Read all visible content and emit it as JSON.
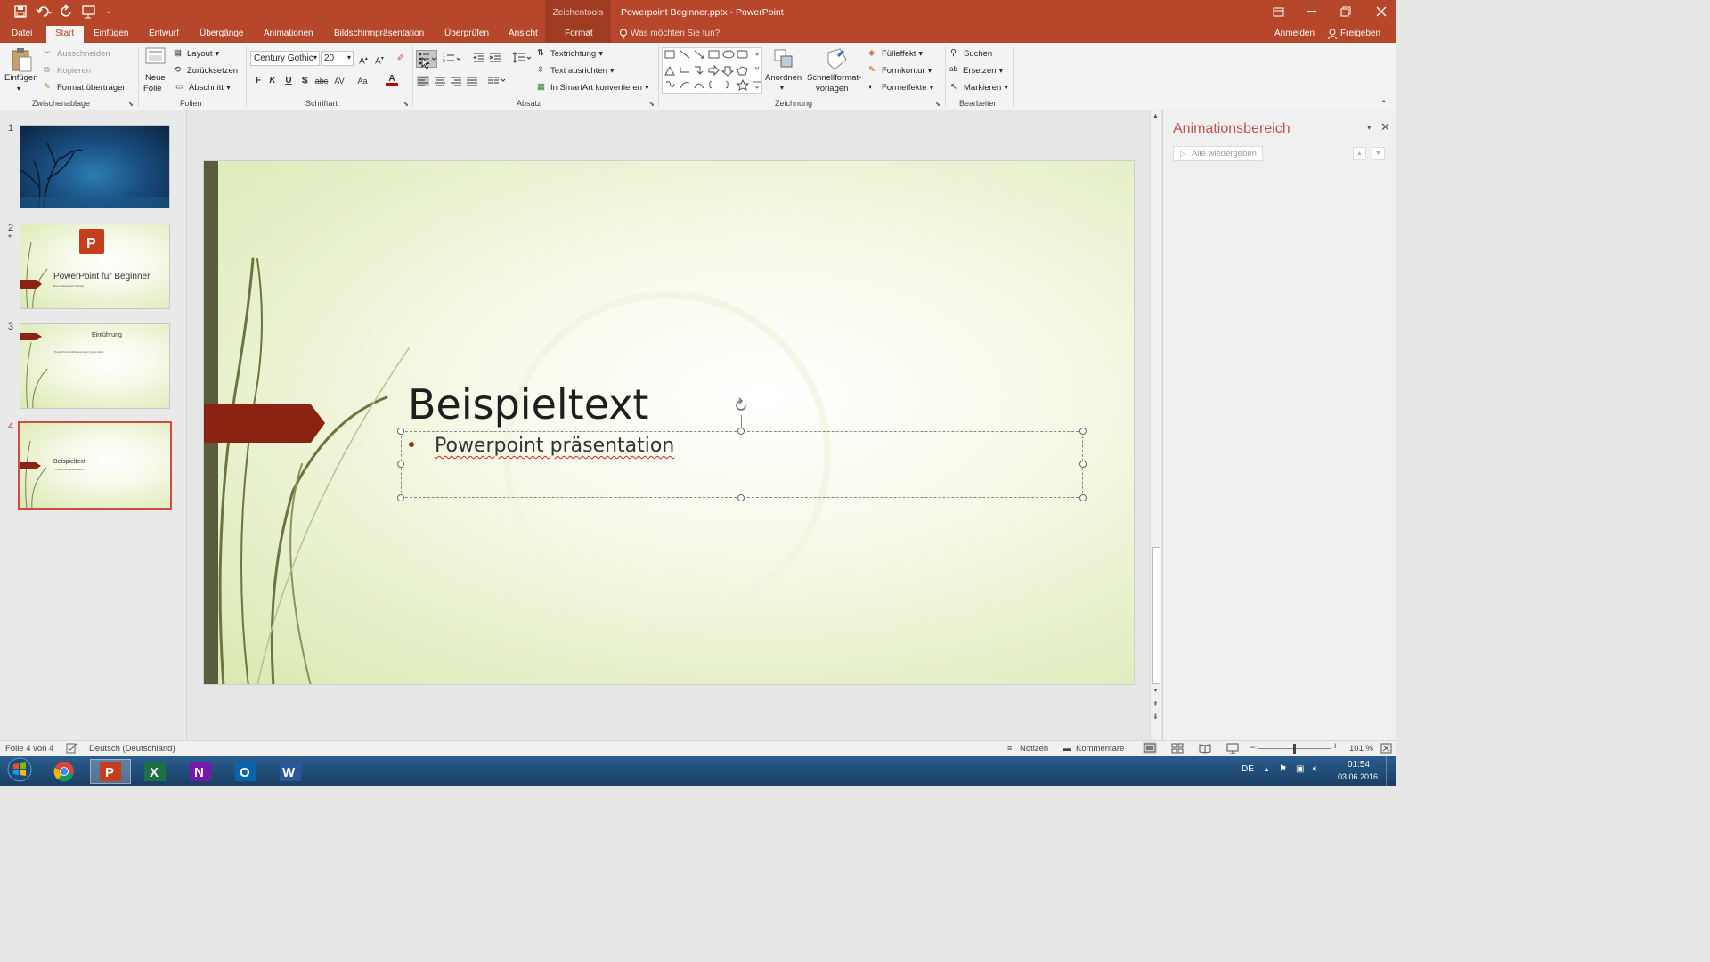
{
  "titlebar": {
    "quick_access_icons": [
      "save-icon",
      "undo-icon",
      "redo-icon",
      "start-presentation-icon",
      "customize-icon"
    ],
    "context_label": "Zeichentools",
    "title": "Powerpoint Beginner.pptx - PowerPoint",
    "window_buttons": [
      "ribbon-display-icon",
      "minimize-icon",
      "restore-icon",
      "close-icon"
    ]
  },
  "tabs": {
    "items": [
      "Datei",
      "Start",
      "Einfügen",
      "Entwurf",
      "Übergänge",
      "Animationen",
      "Bildschirmpräsentation",
      "Überprüfen",
      "Ansicht",
      "Format"
    ],
    "active": "Start",
    "tell_me": "Was möchten Sie tun?",
    "signin": "Anmelden",
    "share": "Freigeben"
  },
  "ribbon": {
    "clipboard": {
      "paste": "Einfügen",
      "cut": "Ausschneiden",
      "copy": "Kopieren",
      "format_painter": "Format übertragen",
      "label": "Zwischenablage"
    },
    "slides": {
      "new_slide_1": "Neue",
      "new_slide_2": "Folie",
      "layout": "Layout",
      "reset": "Zurücksetzen",
      "section": "Abschnitt",
      "label": "Folien"
    },
    "font": {
      "family": "Century Gothic",
      "size": "20",
      "bold": "F",
      "italic": "K",
      "underline": "U",
      "shadow": "S",
      "strike": "abc",
      "spacing": "AV",
      "case": "Aa",
      "color_letter": "A",
      "label": "Schriftart"
    },
    "paragraph": {
      "text_direction": "Textrichtung",
      "align_text": "Text ausrichten",
      "smartart": "In SmartArt konvertieren",
      "label": "Absatz"
    },
    "drawing": {
      "arrange": "Anordnen",
      "quick_styles_1": "Schnellformat-",
      "quick_styles_2": "vorlagen",
      "fill": "Fülleffekt",
      "outline": "Formkontur",
      "effects": "Formeffekte",
      "label": "Zeichnung"
    },
    "editing": {
      "find": "Suchen",
      "replace": "Ersetzen",
      "select": "Markieren",
      "label": "Bearbeiten"
    }
  },
  "slides_panel": {
    "numbers": [
      "1",
      "2",
      "3",
      "4"
    ],
    "star": "*",
    "slide2_title": "PowerPoint für Beginner",
    "slide2_sub": "Das umfassende Training",
    "slide3_title": "Einführung",
    "slide3_bullet": "PowerPoint Einführung lorem ipsum dolor",
    "slide4_title": "Beispieltext",
    "slide4_bullet": "Powerpoint präsentation",
    "active_index": 4
  },
  "slide": {
    "title": "Beispieltext",
    "bullet": "Powerpoint präsentation"
  },
  "animation_pane": {
    "title": "Animationsbereich",
    "play_all": "Alle wiedergeben"
  },
  "statusbar": {
    "slide_info": "Folie 4 von 4",
    "language": "Deutsch (Deutschland)",
    "notes": "Notizen",
    "comments": "Kommentare",
    "zoom": "101 %"
  },
  "taskbar": {
    "apps": [
      "windows-start-icon",
      "chrome-icon",
      "powerpoint-icon",
      "excel-icon",
      "onenote-icon",
      "outlook-icon",
      "word-icon"
    ],
    "lang": "DE",
    "time": "01:54",
    "date": "03.06.2016"
  },
  "colors": {
    "brand": "#b7472a",
    "slide_accent": "#8b2312",
    "slide_bar": "#5a5a3c"
  }
}
